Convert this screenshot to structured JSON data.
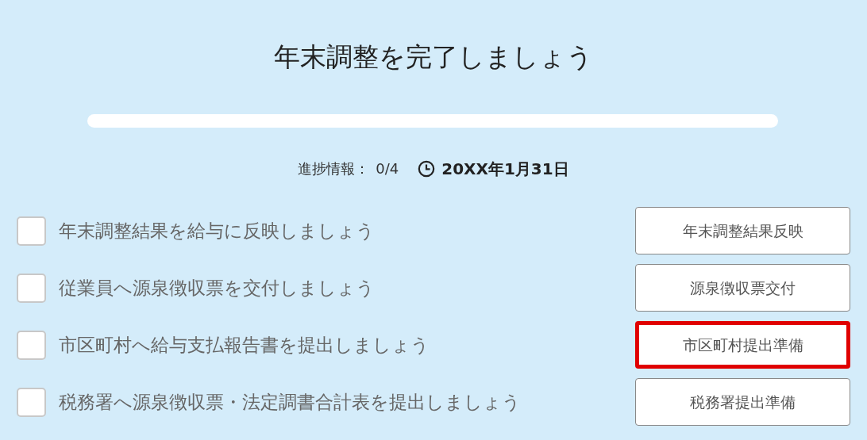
{
  "title": "年末調整を完了しましょう",
  "progress": {
    "level": 0,
    "label": "進捗情報：",
    "count": "0/4",
    "deadline": "20XX年1月31日"
  },
  "tasks": [
    {
      "label": "年末調整結果を給与に反映しましょう",
      "checked": false,
      "button": "年末調整結果反映",
      "highlighted": false
    },
    {
      "label": "従業員へ源泉徴収票を交付しましょう",
      "checked": false,
      "button": "源泉徴収票交付",
      "highlighted": false
    },
    {
      "label": "市区町村へ給与支払報告書を提出しましょう",
      "checked": false,
      "button": "市区町村提出準備",
      "highlighted": true
    },
    {
      "label": "税務署へ源泉徴収票・法定調書合計表を提出しましょう",
      "checked": false,
      "button": "税務署提出準備",
      "highlighted": false
    }
  ]
}
